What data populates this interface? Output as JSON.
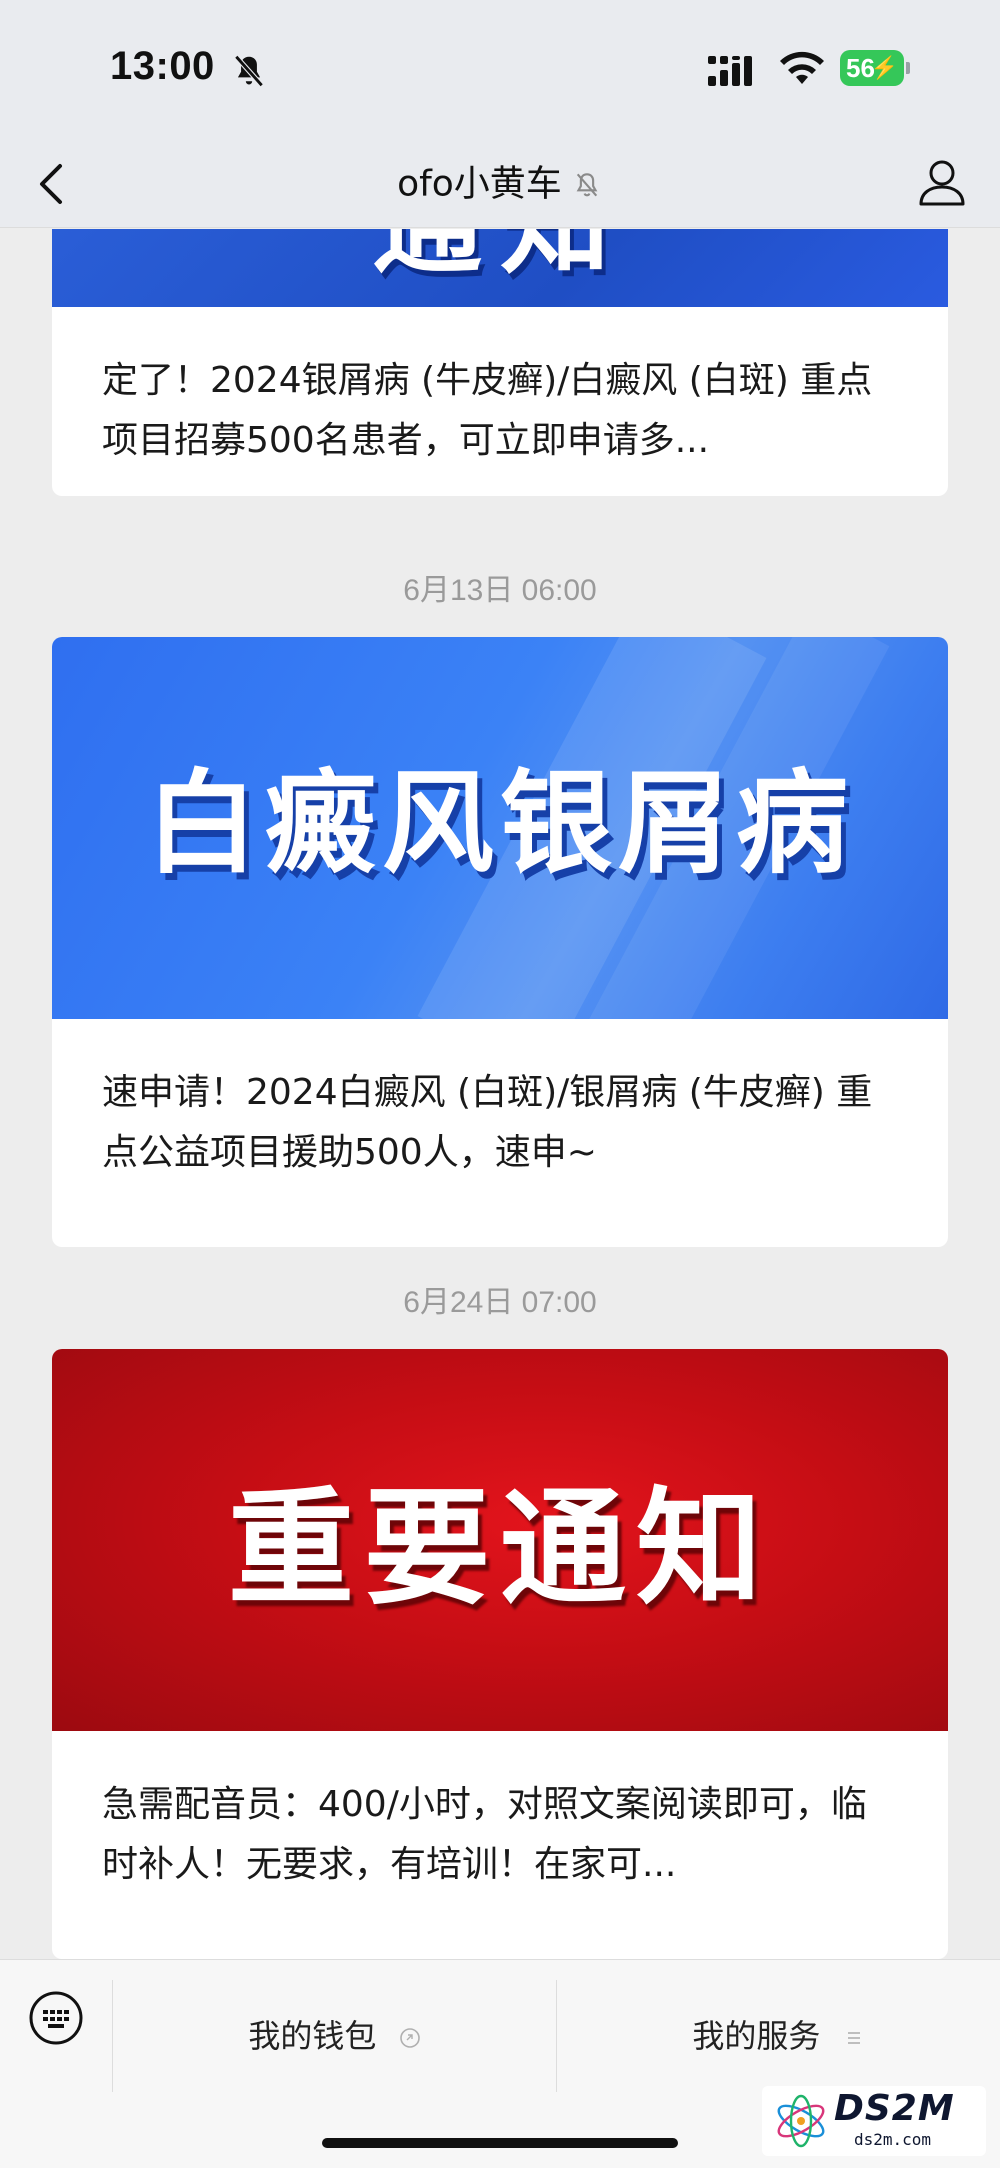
{
  "status_bar": {
    "time": "13:00",
    "battery": "56",
    "icons": [
      "mute-bell-icon",
      "cellular-signal-icon",
      "wifi-icon",
      "battery-charging-icon"
    ]
  },
  "nav": {
    "title": "ofo小黄车",
    "icons": [
      "back-chevron-icon",
      "bell-off-icon",
      "profile-icon"
    ]
  },
  "messages": [
    {
      "time": "",
      "banner_text": "通知",
      "banner_color": "#1f4ec4",
      "text": "定了！2024银屑病 (牛皮癣)/白癜风 (白斑) 重点项目招募500名患者，可立即申请多..."
    },
    {
      "time": "6月13日 06:00",
      "banner_text": "白癜风银屑病",
      "banner_color": "#3b82f6",
      "text": "速申请！2024白癜风 (白斑)/银屑病 (牛皮癣) 重点公益项目援助500人，速申~"
    },
    {
      "time": "6月24日 07:00",
      "banner_text": "重要通知",
      "banner_color": "#c50d14",
      "text": "急需配音员：400/小时，对照文案阅读即可，临时补人！无要求，有培训！在家可..."
    }
  ],
  "bottom_menu": {
    "keyboard_icon": "keyboard-icon",
    "items": [
      {
        "label": "我的钱包",
        "icon": "wallet-sub-icon"
      },
      {
        "label": "我的服务",
        "icon": "menu-lines-icon"
      }
    ]
  },
  "watermark": {
    "brand": "DS2M",
    "domain": "ds2m.com"
  }
}
